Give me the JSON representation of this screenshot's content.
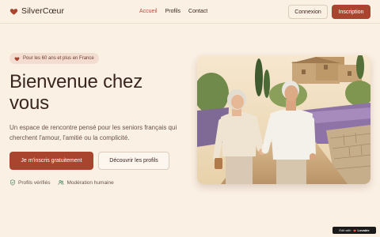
{
  "brand": {
    "name": "SilverCœur",
    "icon": "heart-icon",
    "accent": "#a9452f"
  },
  "nav": {
    "items": [
      {
        "label": "Accueil",
        "active": true
      },
      {
        "label": "Profils",
        "active": false
      },
      {
        "label": "Contact",
        "active": false
      }
    ]
  },
  "header": {
    "login_label": "Connexion",
    "signup_label": "Inscription"
  },
  "hero": {
    "badge": "Pour les 60 ans et plus en France",
    "title": "Bienvenue chez vous",
    "description": "Un espace de rencontre pensé pour les seniors français qui cherchent l'amour, l'amitié ou la complicité.",
    "primary_cta": "Je m'inscris gratuitement",
    "secondary_cta": "Découvrir les profils",
    "trust": [
      {
        "icon": "shield-check-icon",
        "label": "Profils vérifiés"
      },
      {
        "icon": "users-icon",
        "label": "Modération humaine"
      }
    ]
  },
  "edit_badge": {
    "prefix": "Edit with",
    "brand": "Lovable"
  }
}
